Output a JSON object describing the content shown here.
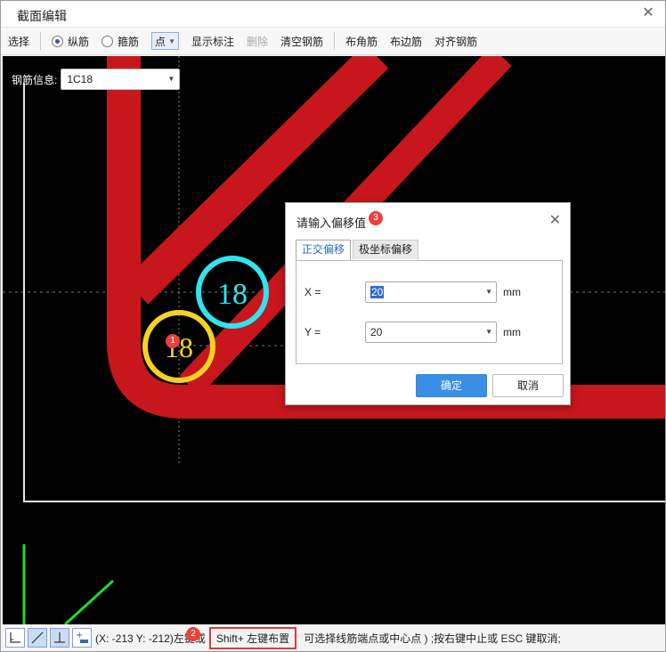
{
  "window": {
    "title": "截面编辑",
    "close_icon": "close-icon"
  },
  "toolbar": {
    "select_label": "选择",
    "longitudinal_label": "纵筋",
    "stirrup_label": "箍筋",
    "mode_value": "点",
    "show_annotation_label": "显示标注",
    "delete_label": "删除",
    "clear_rebar_label": "清空钢筋",
    "corner_rebar_label": "布角筋",
    "edge_rebar_label": "布边筋",
    "align_rebar_label": "对齐钢筋"
  },
  "rebar_info": {
    "label": "钢筋信息:",
    "value": "1C18"
  },
  "canvas": {
    "circle_cyan_label": "18",
    "circle_yellow_label": "18",
    "colors": {
      "background": "#000000",
      "rebar_red": "#c8161d",
      "cyan": "#2ee5ef",
      "yellow": "#f5d21f",
      "axis_green": "#22dd22"
    }
  },
  "badges": {
    "b1": "1",
    "b2": "2",
    "b3": "3"
  },
  "dialog": {
    "title": "请输入偏移值",
    "tab_ortho": "正交偏移",
    "tab_polar": "极坐标偏移",
    "x_label": "X =",
    "x_value": "20",
    "y_label": "Y =",
    "y_value": "20",
    "unit": "mm",
    "ok_label": "确定",
    "cancel_label": "取消"
  },
  "status": {
    "coords": "(X: -213 Y: -212)左键或",
    "shortcut": "Shift+ 左键布置",
    "hint": "可选择线筋端点或中心点 ) ;按右键中止或 ESC 键取消;"
  }
}
